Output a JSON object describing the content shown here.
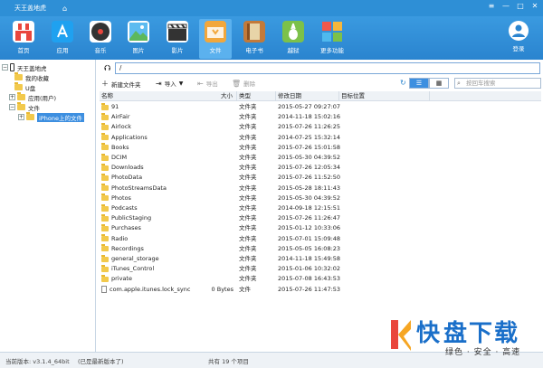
{
  "titlebar": {
    "title": "天王盖地虎",
    "home_glyph": "⌂",
    "apple_glyph": "",
    "btn_menu": "≡",
    "btn_min": "—",
    "btn_max": "□",
    "btn_close": "✕"
  },
  "toolbar": {
    "items": [
      {
        "label": "首页",
        "icon": "store-icon"
      },
      {
        "label": "应用",
        "icon": "appstore-icon"
      },
      {
        "label": "音乐",
        "icon": "music-icon"
      },
      {
        "label": "图片",
        "icon": "photo-icon"
      },
      {
        "label": "影片",
        "icon": "clapper-icon"
      },
      {
        "label": "文件",
        "icon": "folder-icon",
        "active": true
      },
      {
        "label": "电子书",
        "icon": "book-icon"
      },
      {
        "label": "越狱",
        "icon": "pineapple-icon"
      },
      {
        "label": "更多功能",
        "icon": "more-icon"
      }
    ],
    "login_label": "登录"
  },
  "tree": {
    "device": "天王盖地虎",
    "favorites": "我的收藏",
    "udisk": "U盘",
    "apps": "应用(用户)",
    "files": "文件",
    "iphone_files": "iPhone上的文件"
  },
  "pathbar": {
    "path": "/"
  },
  "actions": {
    "new_folder": "新建文件夹",
    "import": "导入",
    "export": "导出",
    "delete": "删除",
    "search_placeholder": "按回车搜索"
  },
  "columns": {
    "name": "名称",
    "size": "大小",
    "type": "类型",
    "date": "修改日期",
    "location": "目标位置"
  },
  "files": [
    {
      "name": "91",
      "size": "",
      "type": "文件夹",
      "date": "2015-05-27 09:27:07",
      "kind": "folder"
    },
    {
      "name": "AirFair",
      "size": "",
      "type": "文件夹",
      "date": "2014-11-18 15:02:16",
      "kind": "folder"
    },
    {
      "name": "Airlock",
      "size": "",
      "type": "文件夹",
      "date": "2015-07-26 11:26:25",
      "kind": "folder"
    },
    {
      "name": "Applications",
      "size": "",
      "type": "文件夹",
      "date": "2014-07-25 15:32:14",
      "kind": "folder"
    },
    {
      "name": "Books",
      "size": "",
      "type": "文件夹",
      "date": "2015-07-26 15:01:58",
      "kind": "folder"
    },
    {
      "name": "DCIM",
      "size": "",
      "type": "文件夹",
      "date": "2015-05-30 04:39:52",
      "kind": "folder"
    },
    {
      "name": "Downloads",
      "size": "",
      "type": "文件夹",
      "date": "2015-07-26 12:05:34",
      "kind": "folder"
    },
    {
      "name": "PhotoData",
      "size": "",
      "type": "文件夹",
      "date": "2015-07-26 11:52:50",
      "kind": "folder"
    },
    {
      "name": "PhotoStreamsData",
      "size": "",
      "type": "文件夹",
      "date": "2015-05-28 18:11:43",
      "kind": "folder"
    },
    {
      "name": "Photos",
      "size": "",
      "type": "文件夹",
      "date": "2015-05-30 04:39:52",
      "kind": "folder"
    },
    {
      "name": "Podcasts",
      "size": "",
      "type": "文件夹",
      "date": "2014-09-18 12:15:51",
      "kind": "folder"
    },
    {
      "name": "PublicStaging",
      "size": "",
      "type": "文件夹",
      "date": "2015-07-26 11:26:47",
      "kind": "folder"
    },
    {
      "name": "Purchases",
      "size": "",
      "type": "文件夹",
      "date": "2015-01-12 10:33:06",
      "kind": "folder"
    },
    {
      "name": "Radio",
      "size": "",
      "type": "文件夹",
      "date": "2015-07-01 15:09:48",
      "kind": "folder"
    },
    {
      "name": "Recordings",
      "size": "",
      "type": "文件夹",
      "date": "2015-05-05 16:08:23",
      "kind": "folder"
    },
    {
      "name": "general_storage",
      "size": "",
      "type": "文件夹",
      "date": "2014-11-18 15:49:58",
      "kind": "folder"
    },
    {
      "name": "iTunes_Control",
      "size": "",
      "type": "文件夹",
      "date": "2015-01-06 10:32:02",
      "kind": "folder"
    },
    {
      "name": "private",
      "size": "",
      "type": "文件夹",
      "date": "2015-07-08 16:43:53",
      "kind": "folder"
    },
    {
      "name": "com.apple.itunes.lock_sync",
      "size": "0 Bytes",
      "type": "文件",
      "date": "2015-07-26 11:47:53",
      "kind": "file"
    }
  ],
  "status": {
    "version": "当前版本: v3.1.4_64bit",
    "note": "(已是最新版本了)",
    "count": "共有 19 个项目"
  },
  "watermark": {
    "char1": "快",
    "char2": "盘下载",
    "slogan": "绿色 · 安全 · 高速"
  }
}
